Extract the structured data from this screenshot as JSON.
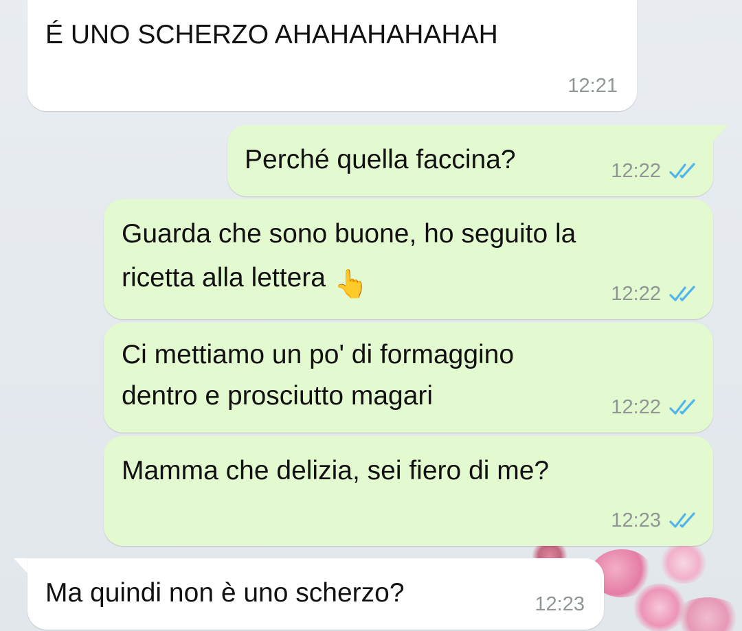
{
  "conversation": {
    "messages": [
      {
        "direction": "incoming",
        "text": "É UNO SCHERZO AHAHAHAHAHAH",
        "time": "12:21"
      },
      {
        "direction": "outgoing",
        "text": "Perché quella faccina?",
        "time": "12:22",
        "status": "read"
      },
      {
        "direction": "outgoing",
        "lines": [
          "Guarda che sono buone, ho seguito la",
          "ricetta alla lettera"
        ],
        "emoji": "👆",
        "emoji_name": "pointing-up-hand-emoji",
        "time": "12:22",
        "status": "read"
      },
      {
        "direction": "outgoing",
        "lines": [
          "Ci mettiamo un po' di formaggino",
          "dentro e prosciutto magari"
        ],
        "time": "12:22",
        "status": "read"
      },
      {
        "direction": "outgoing",
        "text": "Mamma che delizia, sei fiero di me?",
        "time": "12:23",
        "status": "read"
      },
      {
        "direction": "incoming",
        "text": "Ma quindi non è uno scherzo?",
        "time": "12:23"
      }
    ]
  },
  "colors": {
    "incoming_bubble": "#ffffff",
    "outgoing_bubble": "#e3f9cf",
    "timestamp": "#8f9695",
    "read_ticks": "#4fb5ec"
  },
  "icons": {
    "read_receipt": "double-check-icon"
  }
}
